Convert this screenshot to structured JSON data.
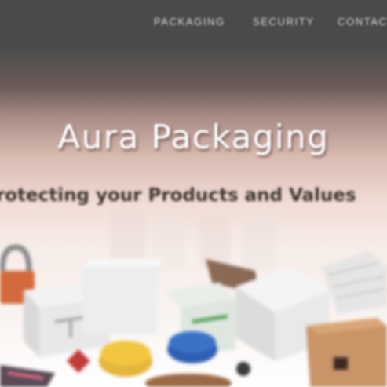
{
  "nav": {
    "items": [
      {
        "label": "PACKAGING"
      },
      {
        "label": "SECURITY"
      },
      {
        "label": "CONTACT"
      }
    ]
  },
  "hero": {
    "title": "Aura Packaging",
    "tagline": "Protecting your Products and Values"
  },
  "colors": {
    "header_dark": "#4a4a4a",
    "hero_pink": "#d9bbb1",
    "title_white": "#ffffff",
    "tagline_text": "#3e3430"
  }
}
